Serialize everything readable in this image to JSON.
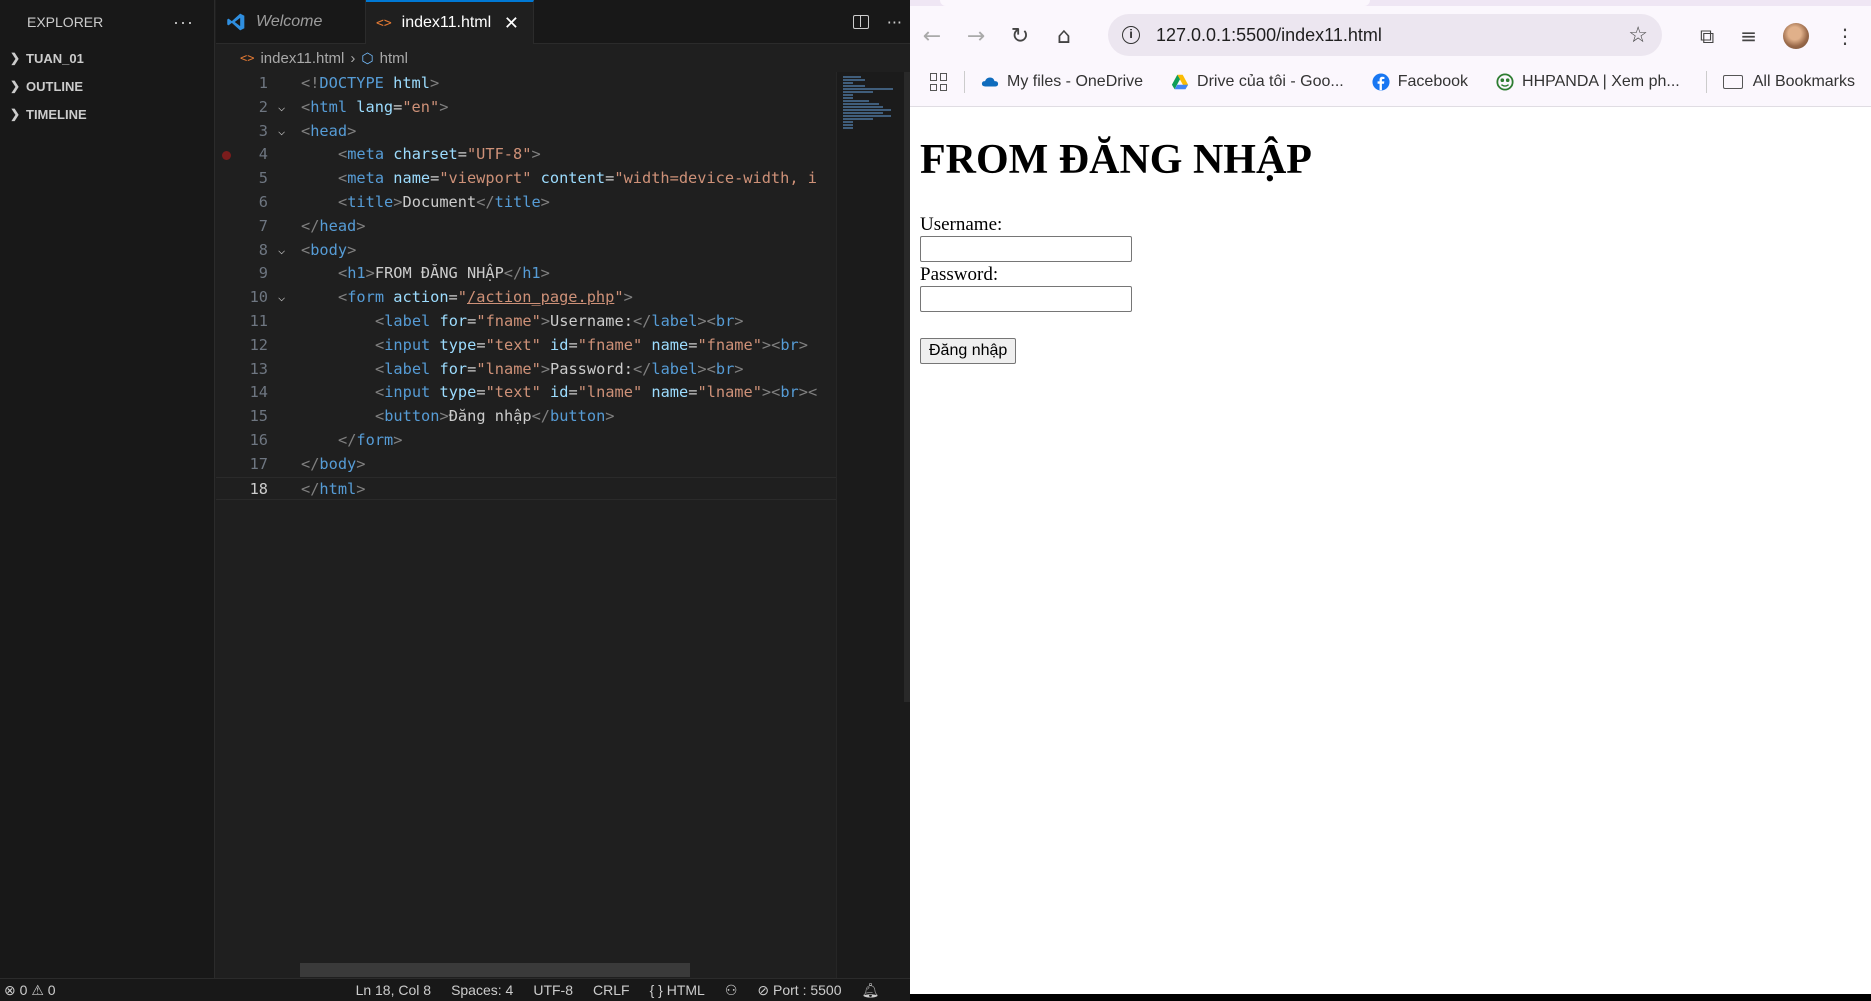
{
  "explorer": {
    "title": "EXPLORER",
    "more": "···",
    "sections": [
      "TUAN_01",
      "OUTLINE",
      "TIMELINE"
    ]
  },
  "editor": {
    "tabs": [
      {
        "label": "Welcome"
      },
      {
        "label": "index11.html",
        "close": "✕"
      }
    ],
    "more": "···",
    "breadcrumb": {
      "file": "index11.html",
      "symbol": "html",
      "sep": "›"
    },
    "lines": [
      "1",
      "2",
      "3",
      "4",
      "5",
      "6",
      "7",
      "8",
      "9",
      "10",
      "11",
      "12",
      "13",
      "14",
      "15",
      "16",
      "17",
      "18"
    ],
    "code": {
      "l1": [
        "<!",
        "DOCTYPE",
        " ",
        "html",
        ">"
      ],
      "l2": [
        "<",
        "html",
        " ",
        "lang",
        "=",
        "\"en\"",
        ">"
      ],
      "l3": [
        "<",
        "head",
        ">"
      ],
      "l4": [
        "<",
        "meta",
        " ",
        "charset",
        "=",
        "\"UTF-8\"",
        ">"
      ],
      "l5": [
        "<",
        "meta",
        " ",
        "name",
        "=",
        "\"viewport\"",
        " ",
        "content",
        "=",
        "\"width=device-width, i"
      ],
      "l6": [
        "<",
        "title",
        ">",
        "Document",
        "</",
        "title",
        ">"
      ],
      "l7": [
        "</",
        "head",
        ">"
      ],
      "l8": [
        "<",
        "body",
        ">"
      ],
      "l9": [
        "<",
        "h1",
        ">",
        "FROM ĐĂNG NHẬP",
        "</",
        "h1",
        ">"
      ],
      "l10": [
        "<",
        "form",
        " ",
        "action",
        "=",
        "\"",
        "/action_page.php",
        "\"",
        ">"
      ],
      "l11": [
        "<",
        "label",
        " ",
        "for",
        "=",
        "\"fname\"",
        ">",
        "Username:",
        "</",
        "label",
        ">",
        "<",
        "br",
        ">"
      ],
      "l12": [
        "<",
        "input",
        " ",
        "type",
        "=",
        "\"text\"",
        " ",
        "id",
        "=",
        "\"fname\"",
        " ",
        "name",
        "=",
        "\"fname\"",
        ">",
        "<",
        "br",
        ">"
      ],
      "l13": [
        "<",
        "label",
        " ",
        "for",
        "=",
        "\"lname\"",
        ">",
        "Password:",
        "</",
        "label",
        ">",
        "<",
        "br",
        ">"
      ],
      "l14": [
        "<",
        "input",
        " ",
        "type",
        "=",
        "\"text\"",
        " ",
        "id",
        "=",
        "\"lname\"",
        " ",
        "name",
        "=",
        "\"lname\"",
        ">",
        "<",
        "br",
        "><"
      ],
      "l15": [
        "<",
        "button",
        ">",
        "Đăng nhập",
        "</",
        "button",
        ">"
      ],
      "l16": [
        "</",
        "form",
        ">"
      ],
      "l17": [
        "</",
        "body",
        ">"
      ],
      "l18": [
        "</",
        "html",
        ">"
      ]
    }
  },
  "statusbar": {
    "errors": "0",
    "warnings": "0",
    "position": "Ln 18, Col 8",
    "spaces": "Spaces: 4",
    "encoding": "UTF-8",
    "eol": "CRLF",
    "language": "HTML",
    "port": "Port : 5500"
  },
  "browser": {
    "url": "127.0.0.1:5500/index11.html",
    "bookmarks": [
      "My files - OneDrive",
      "Drive của tôi - Goo...",
      "Facebook",
      "HHPANDA | Xem ph..."
    ],
    "all_bookmarks": "All Bookmarks",
    "page": {
      "heading": "FROM ĐĂNG NHẬP",
      "username_label": "Username:",
      "password_label": "Password:",
      "button": "Đăng nhập"
    }
  },
  "colors": {
    "accent": "#0078d4",
    "tag": "#569cd6",
    "attr": "#9cdcfe",
    "string": "#ce9178"
  }
}
